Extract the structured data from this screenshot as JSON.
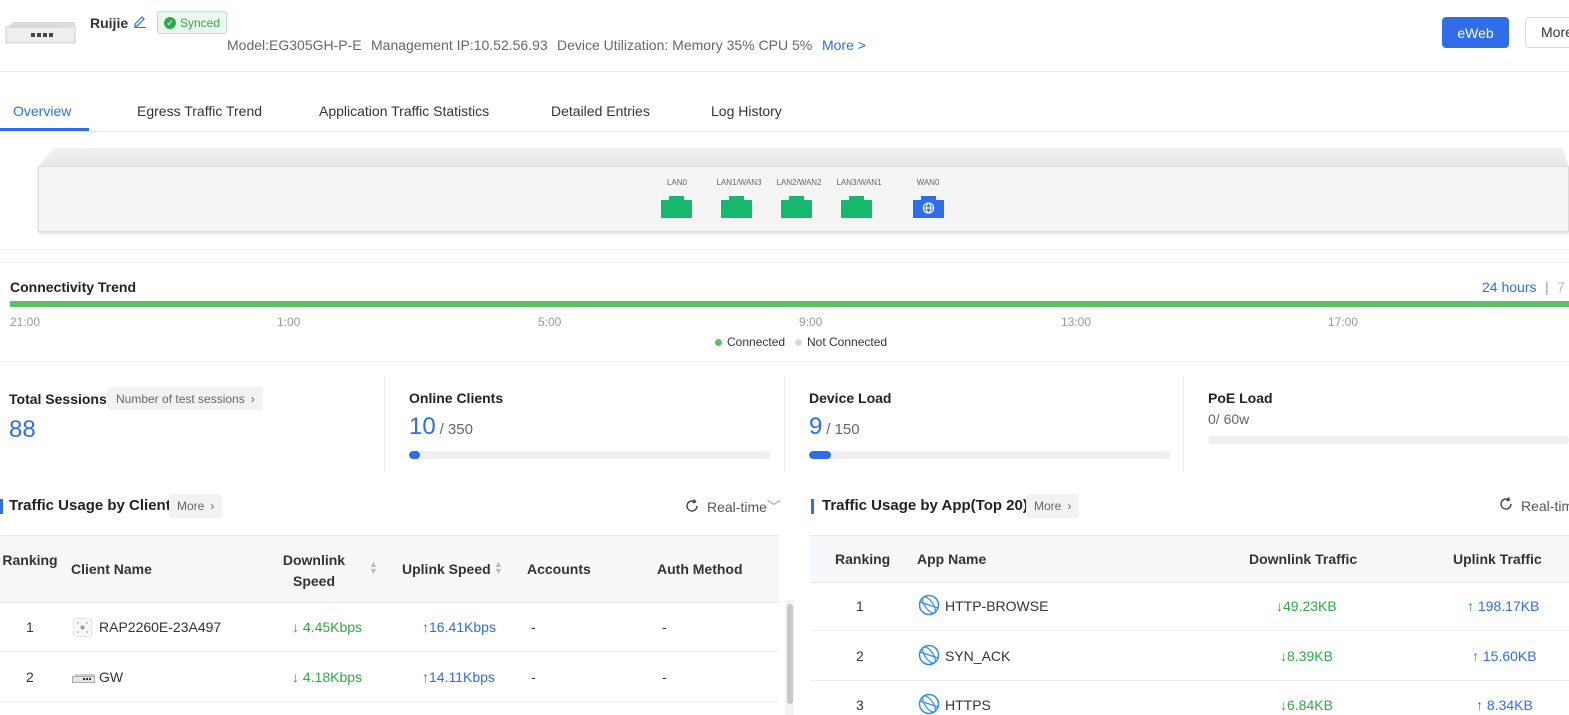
{
  "header": {
    "device_name": "Ruijie",
    "sync_status": "Synced",
    "model": "Model:EG305GH-P-E",
    "management_ip": "Management IP:10.52.56.93",
    "utilization": "Device Utilization: Memory 35% CPU 5%",
    "more_link": "More >",
    "eweb_button": "eWeb",
    "more_button": "More"
  },
  "tabs": [
    {
      "label": "Overview",
      "active": true
    },
    {
      "label": "Egress Traffic Trend"
    },
    {
      "label": "Application Traffic Statistics"
    },
    {
      "label": "Detailed Entries"
    },
    {
      "label": "Log History"
    }
  ],
  "ports": [
    {
      "label": "LAN0",
      "type": "lan",
      "color": "#17b86e"
    },
    {
      "label": "LAN1/WAN3",
      "type": "lan",
      "color": "#17b86e"
    },
    {
      "label": "LAN2/WAN2",
      "type": "lan",
      "color": "#17b86e"
    },
    {
      "label": "LAN3/WAN1",
      "type": "lan",
      "color": "#17b86e"
    },
    {
      "label": "WAN0",
      "type": "wan",
      "color": "#2f6ee8",
      "icon": "globe-icon"
    }
  ],
  "connectivity": {
    "title": "Connectivity Trend",
    "range_selected": "24 hours",
    "range_separator": "|",
    "range_other": "7",
    "ticks": [
      "21:00",
      "1:00",
      "5:00",
      "9:00",
      "13:00",
      "17:00"
    ],
    "legend": [
      {
        "label": "Connected",
        "color": "#5cc166"
      },
      {
        "label": "Not Connected",
        "color": "#d9d9d9"
      }
    ]
  },
  "stats": {
    "total_sessions": {
      "title": "Total Sessions",
      "button": "Number of test sessions",
      "value": "88"
    },
    "online_clients": {
      "title": "Online Clients",
      "value": "10",
      "max": "/ 350",
      "fraction": 0.0286
    },
    "device_load": {
      "title": "Device Load",
      "value": "9",
      "max": "/ 150",
      "fraction": 0.06
    },
    "poe_load": {
      "title": "PoE Load",
      "value": "0/ 60w",
      "fraction": 0
    }
  },
  "client_table": {
    "title": "Traffic Usage by Client",
    "more": "More",
    "period": "Real-time",
    "headers": [
      "Ranking",
      "Client Name",
      "Downlink Speed",
      "Uplink Speed",
      "Accounts",
      "Auth Method"
    ],
    "rows": [
      {
        "rank": "1",
        "name": "RAP2260E-23A497",
        "down": "↓ 4.45Kbps",
        "up": "↑16.41Kbps",
        "accounts": "-",
        "auth": "-",
        "icon": "access-point-icon"
      },
      {
        "rank": "2",
        "name": "GW",
        "down": "↓ 4.18Kbps",
        "up": "↑14.11Kbps",
        "accounts": "-",
        "auth": "-",
        "icon": "gateway-icon"
      }
    ]
  },
  "app_table": {
    "title": "Traffic Usage by App(Top 20)",
    "more": "More",
    "period": "Real-tim",
    "headers": [
      "Ranking",
      "App Name",
      "Downlink Traffic",
      "Uplink Traffic"
    ],
    "rows": [
      {
        "rank": "1",
        "name": "HTTP-BROWSE",
        "down": "↓49.23KB",
        "up": "↑ 198.17KB"
      },
      {
        "rank": "2",
        "name": "SYN_ACK",
        "down": "↓8.39KB",
        "up": "↑ 15.60KB"
      },
      {
        "rank": "3",
        "name": "HTTPS",
        "down": "↓6.84KB",
        "up": "↑ 8.34KB"
      }
    ]
  }
}
